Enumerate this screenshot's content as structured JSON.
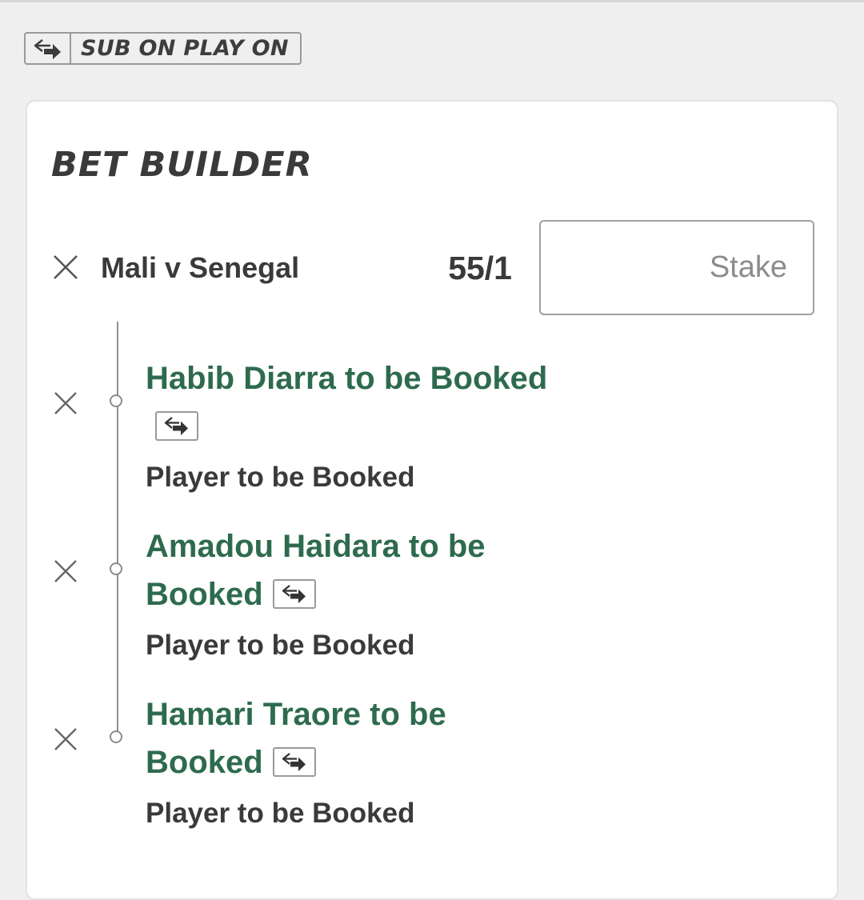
{
  "badge": {
    "label": "SUB ON PLAY ON",
    "icon": "substitution-arrows-icon"
  },
  "bet_builder": {
    "title": "BET BUILDER",
    "event": {
      "name": "Mali v Senegal",
      "odds": "55/1",
      "stake_placeholder": "Stake",
      "stake_value": ""
    },
    "legs": [
      {
        "selection": "Habib Diarra to be Booked",
        "market": "Player to be Booked",
        "icon": "substitution-arrows-icon"
      },
      {
        "selection": "Amadou Haidara to be Booked",
        "market": "Player to be Booked",
        "icon": "substitution-arrows-icon"
      },
      {
        "selection": "Hamari Traore to be Booked",
        "market": "Player to be Booked",
        "icon": "substitution-arrows-icon"
      }
    ]
  },
  "colors": {
    "selection_green": "#2e6b4e",
    "text_dark": "#3a3a3a",
    "page_background": "#efefef",
    "card_background": "#ffffff"
  }
}
